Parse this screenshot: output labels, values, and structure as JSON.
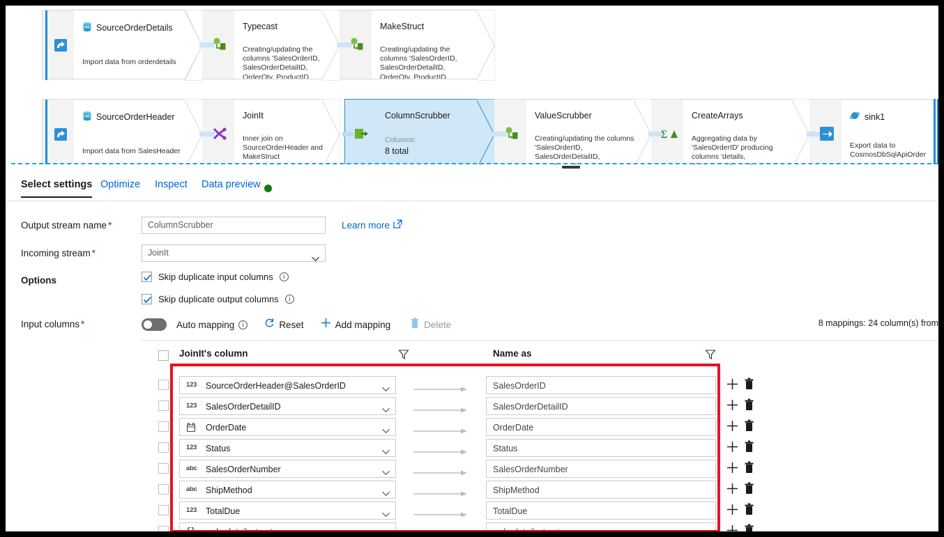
{
  "flow": {
    "row1": [
      {
        "name": "SourceOrderDetails",
        "desc": "Import data from orderdetails",
        "icon": "sql-database-icon",
        "kind": "source",
        "single": true
      },
      {
        "name": "Typecast",
        "desc": "Creating/updating the columns 'SalesOrderID, SalesOrderDetailID, OrderQty, ProductID, UnitPrice,",
        "icon": "derived-column-icon",
        "kind": "transform"
      },
      {
        "name": "MakeStruct",
        "desc": "Creating/updating the columns 'SalesOrderID, SalesOrderDetailID, OrderQty, ProductID, UnitPrice,",
        "icon": "derived-column-icon",
        "kind": "transform"
      }
    ],
    "row2": [
      {
        "name": "SourceOrderHeader",
        "desc": "Import data from SalesHeader",
        "icon": "sql-database-icon",
        "kind": "source",
        "single": true
      },
      {
        "name": "JoinIt",
        "desc": "Inner join on SourceOrderHeader and MakeStruct",
        "icon": "join-icon",
        "kind": "transform"
      },
      {
        "name": "ColumnScrubber",
        "desc_label": "Columns:",
        "desc": "8 total",
        "icon": "select-icon",
        "kind": "transform",
        "selected": true
      },
      {
        "name": "ValueScrubber",
        "desc": "Creating/updating the columns 'SalesOrderID, SalesOrderDetailID, OrderDate, Status, SalesOrderNumber,",
        "icon": "derived-column-icon",
        "kind": "transform"
      },
      {
        "name": "CreateArrays",
        "desc": "Aggregating data by 'SalesOrderID' producing columns 'details, SalesOrderDetailID, OrderDate,",
        "icon": "aggregate-icon",
        "kind": "transform"
      },
      {
        "name": "sink1",
        "desc": "Export data to CosmosDbSqlApiOrders",
        "icon": "cosmos-db-icon",
        "kind": "sink",
        "single": true
      }
    ]
  },
  "tabs": [
    {
      "label": "Select settings",
      "active": true
    },
    {
      "label": "Optimize",
      "active": false
    },
    {
      "label": "Inspect",
      "active": false
    },
    {
      "label": "Data preview",
      "active": false
    }
  ],
  "form": {
    "output_stream_label": "Output stream name",
    "output_stream_value": "ColumnScrubber",
    "incoming_stream_label": "Incoming stream",
    "incoming_stream_value": "JoinIt",
    "options_label": "Options",
    "learn_more": "Learn more",
    "checkboxes": [
      {
        "label": "Skip duplicate input columns",
        "checked": true
      },
      {
        "label": "Skip duplicate output columns",
        "checked": true
      }
    ],
    "input_columns_label": "Input columns"
  },
  "toolbar": {
    "auto_mapping_label": "Auto mapping",
    "auto_mapping_on": false,
    "reset_label": "Reset",
    "add_mapping_label": "Add mapping",
    "delete_label": "Delete",
    "mapping_summary": "8 mappings: 24 column(s) from"
  },
  "table": {
    "col_source_header": "JoinIt's column",
    "col_target_header": "Name as",
    "rows": [
      {
        "type": "123",
        "source": "SourceOrderHeader@SalesOrderID",
        "target": "SalesOrderID"
      },
      {
        "type": "123",
        "source": "SalesOrderDetailID",
        "target": "SalesOrderDetailID"
      },
      {
        "type": "date",
        "source": "OrderDate",
        "target": "OrderDate"
      },
      {
        "type": "123",
        "source": "Status",
        "target": "Status"
      },
      {
        "type": "abc",
        "source": "SalesOrderNumber",
        "target": "SalesOrderNumber"
      },
      {
        "type": "abc",
        "source": "ShipMethod",
        "target": "ShipMethod"
      },
      {
        "type": "123",
        "source": "TotalDue",
        "target": "TotalDue"
      },
      {
        "type": "{}",
        "source": "orderdetailsstruct",
        "target": "orderdetailsstruct"
      }
    ]
  },
  "colors": {
    "accent_blue": "#0066cc",
    "selected_node": "#cfe7f7",
    "selected_border": "#2b8fc9",
    "highlight_red": "#e81123",
    "status_green": "#0e7a0e"
  }
}
